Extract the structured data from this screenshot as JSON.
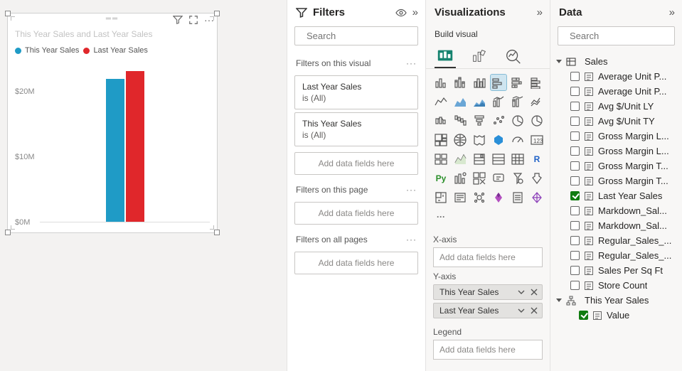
{
  "chart_data": {
    "type": "bar",
    "title": "This Year Sales and Last Year Sales",
    "series": [
      {
        "name": "This Year Sales",
        "color": "#1f9bc6",
        "values": [
          22000000
        ]
      },
      {
        "name": "Last Year Sales",
        "color": "#e0272b",
        "values": [
          23200000
        ]
      }
    ],
    "categories": [
      ""
    ],
    "xlabel": "",
    "ylabel": "",
    "ylim": [
      0,
      25000000
    ],
    "yticks": [
      {
        "v": 0,
        "label": "$0M"
      },
      {
        "v": 10000000,
        "label": "$10M"
      },
      {
        "v": 20000000,
        "label": "$20M"
      }
    ]
  },
  "filters": {
    "title": "Filters",
    "search_placeholder": "Search",
    "visual_section": "Filters on this visual",
    "page_section": "Filters on this page",
    "all_section": "Filters on all pages",
    "add_placeholder": "Add data fields here",
    "cards": [
      {
        "name": "Last Year Sales",
        "sub": "is (All)"
      },
      {
        "name": "This Year Sales",
        "sub": "is (All)"
      }
    ]
  },
  "viz": {
    "title": "Visualizations",
    "build_label": "Build visual",
    "xaxis_label": "X-axis",
    "yaxis_label": "Y-axis",
    "legend_label": "Legend",
    "add_placeholder": "Add data fields here",
    "yfields": [
      "This Year Sales",
      "Last Year Sales"
    ]
  },
  "data": {
    "title": "Data",
    "search_placeholder": "Search",
    "tables": [
      {
        "name": "Sales",
        "expanded": true,
        "fields": [
          {
            "name": "Average Unit P...",
            "checked": false,
            "icon": "measure"
          },
          {
            "name": "Average Unit P...",
            "checked": false,
            "icon": "measure"
          },
          {
            "name": "Avg $/Unit LY",
            "checked": false,
            "icon": "measure"
          },
          {
            "name": "Avg $/Unit TY",
            "checked": false,
            "icon": "measure"
          },
          {
            "name": "Gross Margin L...",
            "checked": false,
            "icon": "measure"
          },
          {
            "name": "Gross Margin L...",
            "checked": false,
            "icon": "measure"
          },
          {
            "name": "Gross Margin T...",
            "checked": false,
            "icon": "measure"
          },
          {
            "name": "Gross Margin T...",
            "checked": false,
            "icon": "measure"
          },
          {
            "name": "Last Year Sales",
            "checked": true,
            "icon": "measure"
          },
          {
            "name": "Markdown_Sal...",
            "checked": false,
            "icon": "measure"
          },
          {
            "name": "Markdown_Sal...",
            "checked": false,
            "icon": "measure"
          },
          {
            "name": "Regular_Sales_...",
            "checked": false,
            "icon": "measure"
          },
          {
            "name": "Regular_Sales_...",
            "checked": false,
            "icon": "measure"
          },
          {
            "name": "Sales Per Sq Ft",
            "checked": false,
            "icon": "measure"
          },
          {
            "name": "Store Count",
            "checked": false,
            "icon": "measure"
          }
        ],
        "hierarchies": [
          {
            "name": "This Year Sales",
            "checked_indeterminate": true,
            "children": [
              {
                "name": "Value",
                "checked": true
              }
            ]
          }
        ]
      }
    ]
  }
}
